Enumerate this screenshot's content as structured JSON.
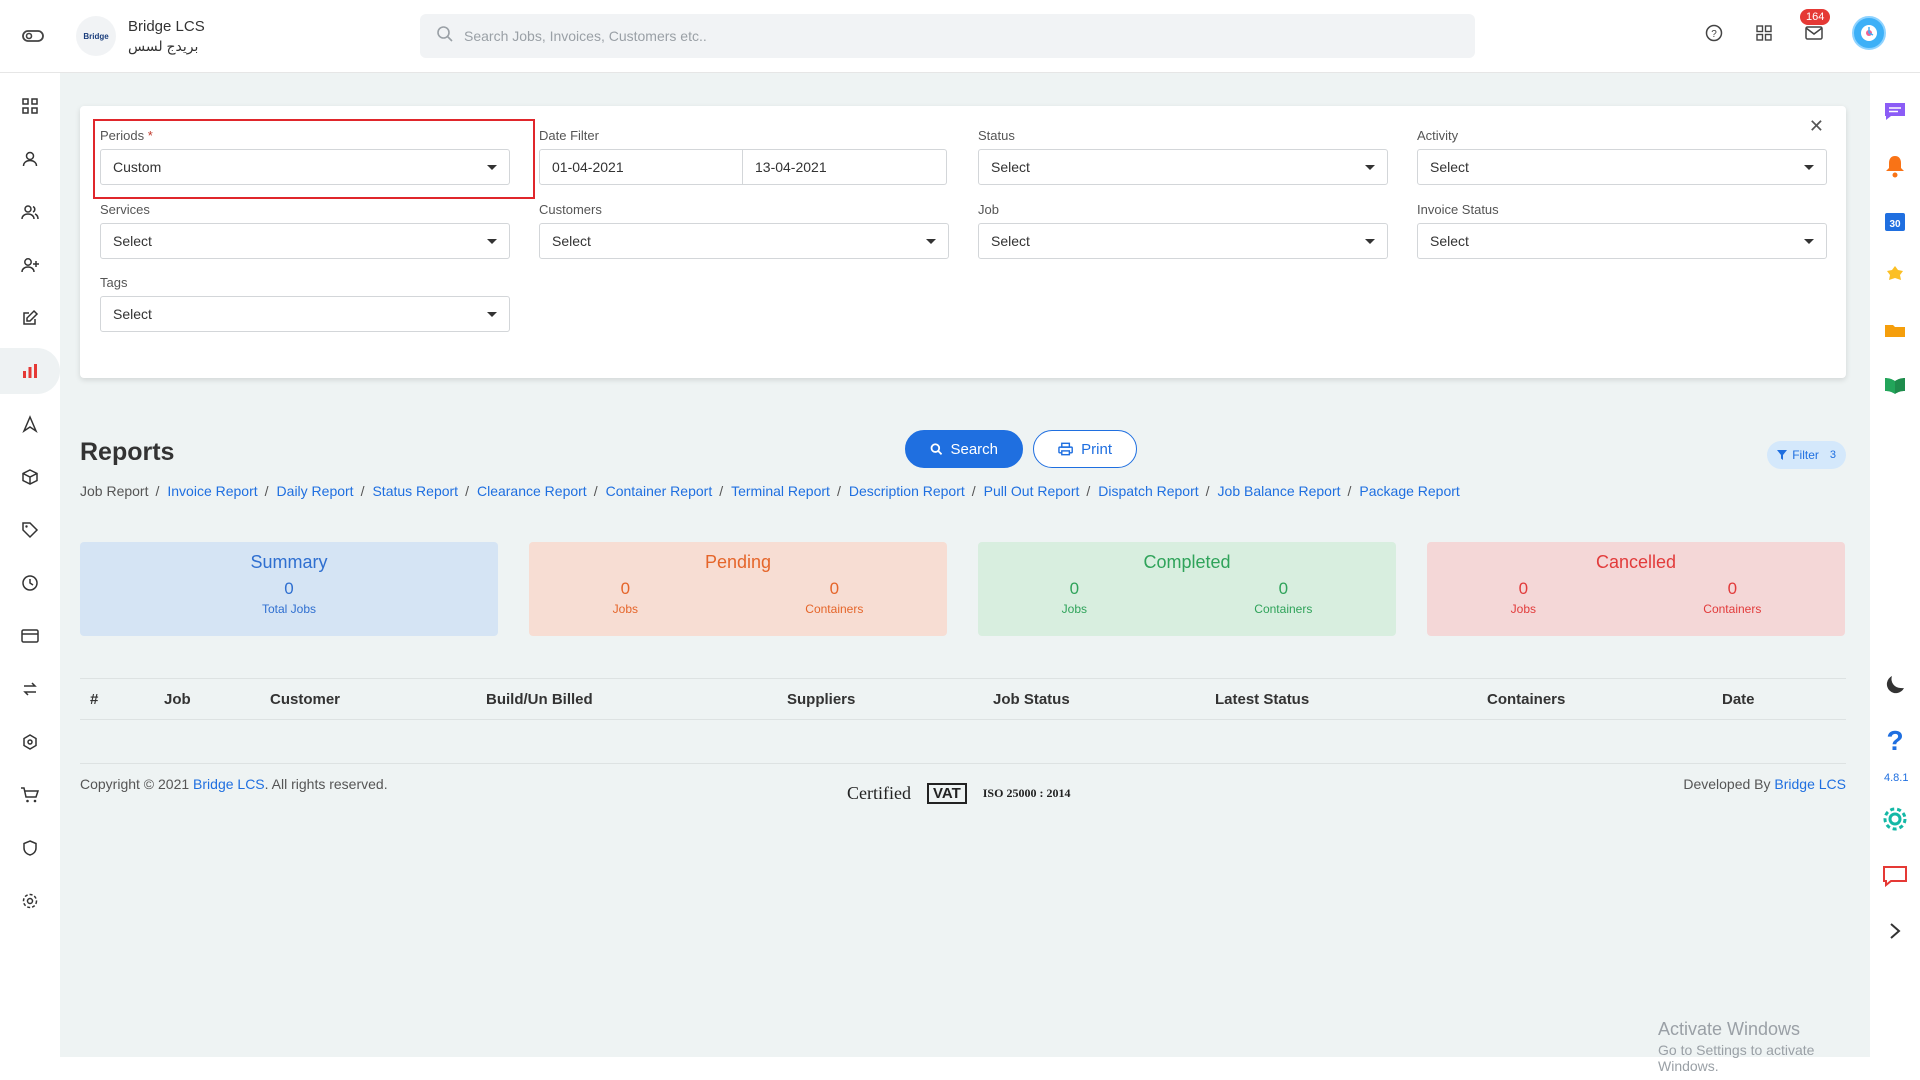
{
  "header": {
    "brand_name": "Bridge LCS",
    "brand_arabic": "بريدج لسس",
    "brand_logo_text": "Bridge",
    "search_placeholder": "Search Jobs, Invoices, Customers etc..",
    "notification_count": "164"
  },
  "filters": {
    "periods_label": "Periods",
    "periods_required": "*",
    "periods_value": "Custom",
    "date_filter_label": "Date Filter",
    "date_from": "01-04-2021",
    "date_to": "13-04-2021",
    "status_label": "Status",
    "status_value": "Select",
    "activity_label": "Activity",
    "activity_value": "Select",
    "services_label": "Services",
    "services_value": "Select",
    "customers_label": "Customers",
    "customers_value": "Select",
    "job_label": "Job",
    "job_value": "Select",
    "invoice_status_label": "Invoice Status",
    "invoice_status_value": "Select",
    "tags_label": "Tags",
    "tags_value": "Select",
    "search_button": "Search",
    "print_button": "Print"
  },
  "reports": {
    "title": "Reports",
    "filter_pill_label": "Filter",
    "filter_pill_count": "3",
    "breadcrumb": [
      "Job Report",
      "Invoice Report",
      "Daily Report",
      "Status Report",
      "Clearance Report",
      "Container Report",
      "Terminal Report",
      "Description Report",
      "Pull Out Report",
      "Dispatch Report",
      "Job Balance Report",
      "Package Report"
    ]
  },
  "stats": {
    "summary": {
      "title": "Summary",
      "value": "0",
      "label": "Total Jobs"
    },
    "pending": {
      "title": "Pending",
      "jobs": "0",
      "jobs_label": "Jobs",
      "containers": "0",
      "containers_label": "Containers"
    },
    "completed": {
      "title": "Completed",
      "jobs": "0",
      "jobs_label": "Jobs",
      "containers": "0",
      "containers_label": "Containers"
    },
    "cancelled": {
      "title": "Cancelled",
      "jobs": "0",
      "jobs_label": "Jobs",
      "containers": "0",
      "containers_label": "Containers"
    }
  },
  "table": {
    "columns": [
      "#",
      "Job",
      "Customer",
      "Build/Un Billed",
      "Suppliers",
      "Job Status",
      "Latest Status",
      "Containers",
      "Date"
    ]
  },
  "footer": {
    "copyright_prefix": "Copyright © 2021",
    "copyright_link": "Bridge LCS",
    "copyright_suffix": ". All rights reserved.",
    "developed_prefix": "Developed By",
    "developed_link": "Bridge LCS",
    "logo_certified": "Certified",
    "logo_vat": "VAT",
    "logo_iso": "ISO 25000 : 2014"
  },
  "right_sidebar": {
    "version": "4.8.1",
    "calendar_day": "30"
  },
  "windows_watermark": {
    "line1": "Activate Windows",
    "line2": "Go to Settings to activate Windows."
  },
  "colors": {
    "primary": "#1f6fe0",
    "highlight_border": "#e0262b",
    "badge": "#e53935"
  }
}
